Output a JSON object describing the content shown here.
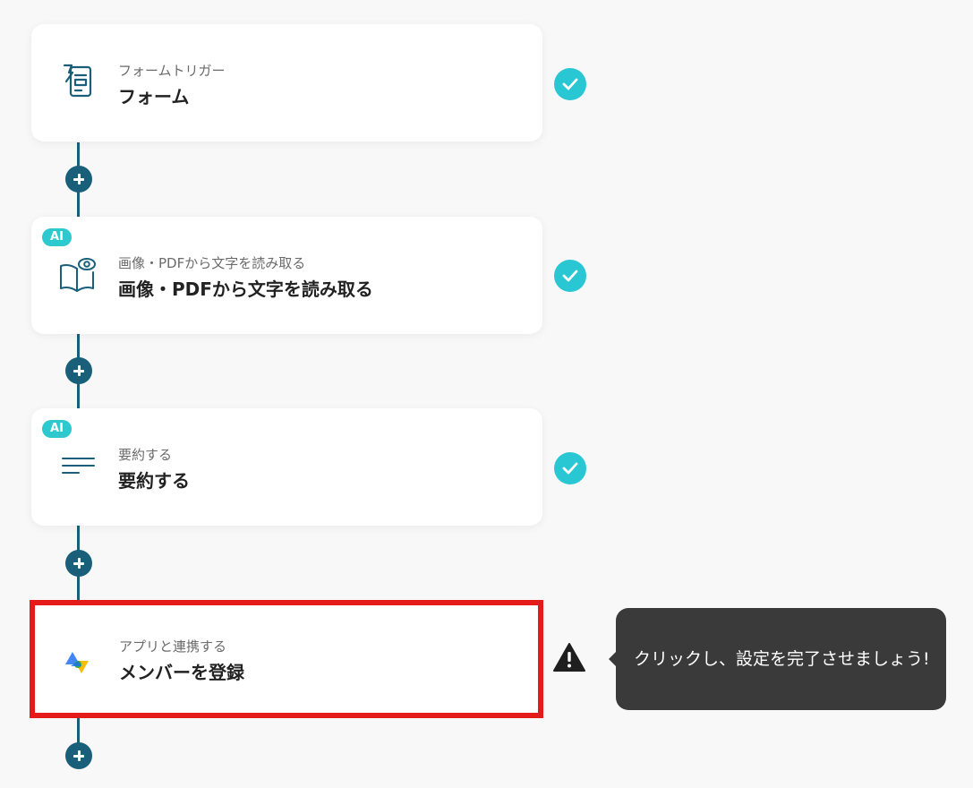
{
  "steps": [
    {
      "type_label": "フォームトリガー",
      "title": "フォーム",
      "icon": "form-icon",
      "ai": false,
      "status": "complete"
    },
    {
      "type_label": "画像・PDFから文字を読み取る",
      "title": "画像・PDFから文字を読み取る",
      "icon": "ocr-book-icon",
      "ai": true,
      "ai_label": "AI",
      "status": "complete"
    },
    {
      "type_label": "要約する",
      "title": "要約する",
      "icon": "summary-lines-icon",
      "ai": true,
      "ai_label": "AI",
      "status": "complete"
    },
    {
      "type_label": "アプリと連携する",
      "title": "メンバーを登録",
      "icon": "google-admin-icon",
      "ai": false,
      "status": "warning"
    }
  ],
  "tooltip": {
    "text": "クリックし、設定を完了させましょう!"
  },
  "colors": {
    "connector": "#1a5f7a",
    "check": "#29c6d4",
    "ai_badge": "#2ec9cf",
    "highlight_border": "#e51b1b",
    "tooltip_bg": "#3a3a3a"
  }
}
